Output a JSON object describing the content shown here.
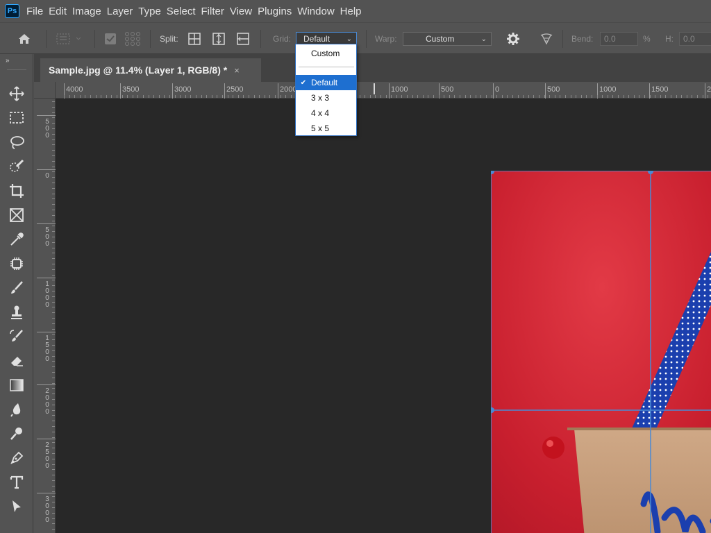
{
  "app": {
    "logo": "Ps",
    "accent": "#31a8ff"
  },
  "menubar": {
    "items": [
      "File",
      "Edit",
      "Image",
      "Layer",
      "Type",
      "Select",
      "Filter",
      "View",
      "Plugins",
      "Window",
      "Help"
    ]
  },
  "options": {
    "split_label": "Split:",
    "grid_label": "Grid:",
    "grid_value": "Default",
    "warp_label": "Warp:",
    "warp_value": "Custom",
    "bend_label": "Bend:",
    "bend_value": "0.0",
    "bend_unit": "%",
    "h_label": "H:",
    "h_value": "0.0"
  },
  "grid_dropdown": {
    "top_option": "Custom",
    "options": [
      "Default",
      "3 x 3",
      "4 x 4",
      "5 x 5"
    ],
    "selected": "Default",
    "check_mark": "✔"
  },
  "document": {
    "tab_title": "Sample.jpg @ 11.4% (Layer 1, RGB/8) *",
    "close_glyph": "×"
  },
  "rulers": {
    "horizontal": [
      "4000",
      "3500",
      "3000",
      "2500",
      "2000",
      "1000",
      "500",
      "0",
      "500",
      "1000",
      "1500",
      "2"
    ],
    "vertical": [
      [
        "5",
        "0",
        "0"
      ],
      [
        "0"
      ],
      [
        "5",
        "0",
        "0"
      ],
      [
        "1",
        "0",
        "0",
        "0"
      ],
      [
        "1",
        "5",
        "0",
        "0"
      ],
      [
        "2",
        "0",
        "0",
        "0"
      ],
      [
        "2",
        "5",
        "0",
        "0"
      ],
      [
        "3",
        "0",
        "0",
        "0"
      ]
    ]
  },
  "toolbar": {
    "collapse_glyph": "»",
    "tools": [
      "move-tool",
      "marquee-tool",
      "lasso-tool",
      "quick-selection-tool",
      "crop-tool",
      "frame-tool",
      "eyedropper-tool",
      "spot-healing-tool",
      "brush-tool",
      "clone-stamp-tool",
      "history-brush-tool",
      "eraser-tool",
      "gradient-tool",
      "blur-tool",
      "dodge-tool",
      "pen-tool",
      "type-tool",
      "path-selection-tool"
    ]
  },
  "colors": {
    "image_background": "#d3202f",
    "warp_grid": "#4a8ad4",
    "dropdown_highlight": "#1e6fd0"
  }
}
